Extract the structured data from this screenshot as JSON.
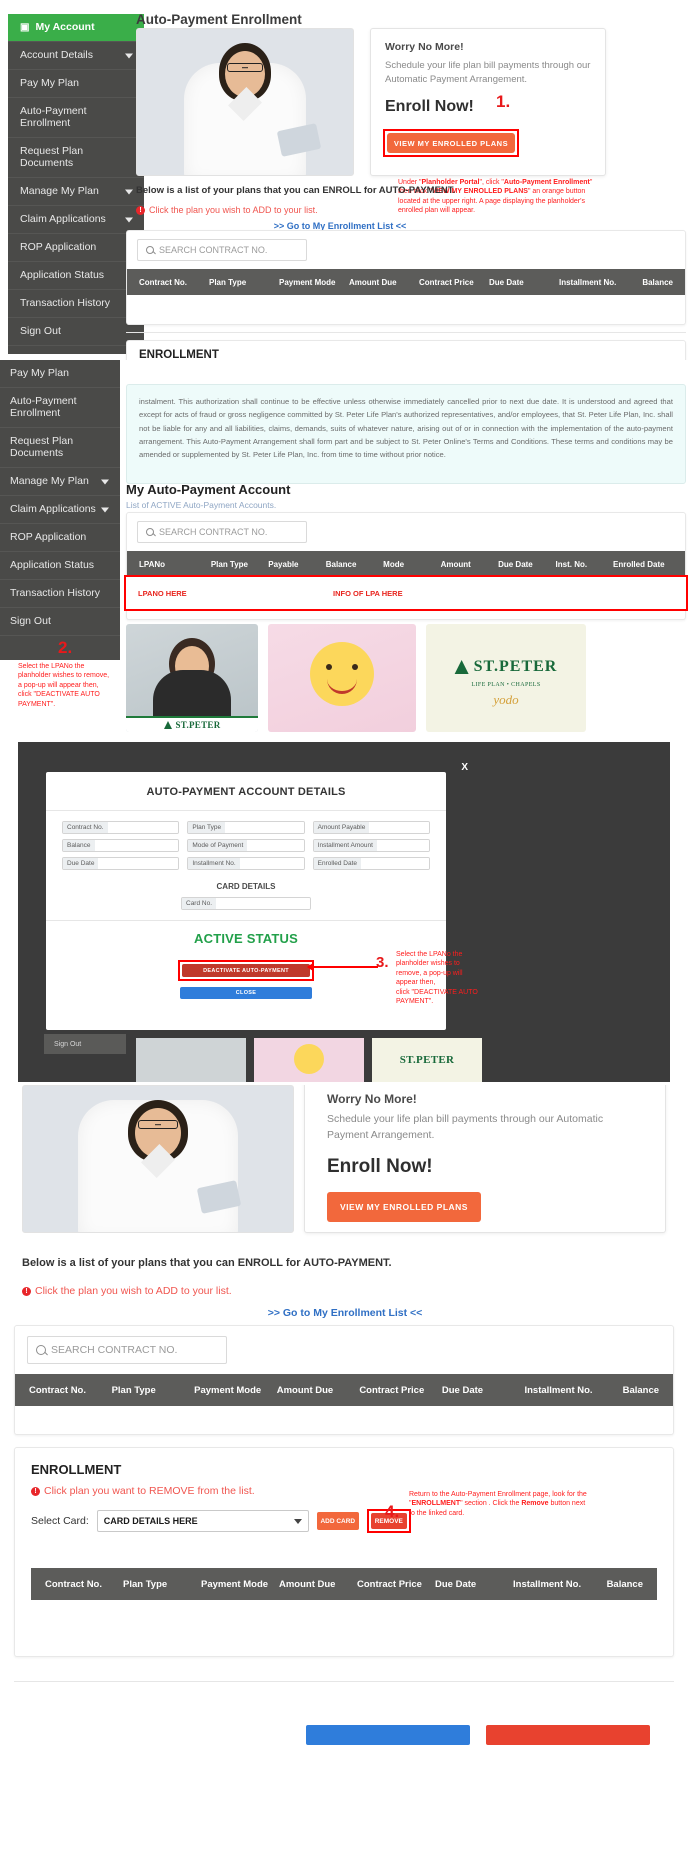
{
  "page": {
    "title": "Auto-Payment Enrollment"
  },
  "sidebar": {
    "items": [
      {
        "label": "My Account",
        "icon": "briefcase-icon",
        "active": true,
        "caret": false
      },
      {
        "label": "Account Details",
        "active": false,
        "caret": true
      },
      {
        "label": "Pay My Plan",
        "active": false,
        "caret": false
      },
      {
        "label": "Auto-Payment Enrollment",
        "active": false,
        "caret": false,
        "two_line": true
      },
      {
        "label": "Request Plan Documents",
        "active": false,
        "caret": false,
        "two_line": true
      },
      {
        "label": "Manage My Plan",
        "active": false,
        "caret": true
      },
      {
        "label": "Claim Applications",
        "active": false,
        "caret": true
      },
      {
        "label": "ROP Application",
        "active": false,
        "caret": false
      },
      {
        "label": "Application Status",
        "active": false,
        "caret": false
      },
      {
        "label": "Transaction History",
        "active": false,
        "caret": false
      },
      {
        "label": "Sign Out",
        "active": false,
        "caret": false
      }
    ]
  },
  "promo": {
    "heading": "Worry No More!",
    "body": "Schedule your life plan bill payments through our Automatic Payment Arrangement.",
    "cta_heading": "Enroll Now!",
    "button_label": "VIEW MY ENROLLED PLANS"
  },
  "callouts": {
    "one": {
      "number": "1.",
      "text_html": "Under \"<b>Planholder Portal</b>\", click \"<b>Auto-Payment Enrollment</b>\" then click \"<b>VIEW MY ENROLLED PLANS</b>\" an orange button located at the upper right. A page displaying the planholder's enrolled plan will appear."
    },
    "two": {
      "number": "2.",
      "text_html": "Select the LPANo the planholder wishes to remove, a pop-up will appear then, click \"DEACTIVATE AUTO PAYMENT\"."
    },
    "three": {
      "number": "3.",
      "text_html": "Select the LPANo the planholder wishes to remove, a pop-up will appear then, click \"DEACTIVATE AUTO PAYMENT\"."
    },
    "four": {
      "number": "4.",
      "text_html": "Return to the Auto-Payment Enrollment page, look for the \"<b>ENROLLMENT</b>\" section . Click the <b>Remove</b> button next to the linked card."
    }
  },
  "enroll_list": {
    "lead": "Below is a list of your plans that you can ENROLL for AUTO-PAYMENT.",
    "warning": "Click the plan you wish to ADD to your list.",
    "go_link": ">> Go to My Enrollment List <<",
    "search_placeholder": "SEARCH CONTRACT NO.",
    "columns": [
      "Contract No.",
      "Plan Type",
      "Payment Mode",
      "Amount Due",
      "Contract Price",
      "Due Date",
      "Installment No.",
      "Balance"
    ]
  },
  "enrollment_panel": {
    "title": "ENROLLMENT",
    "warning": "Click plan you want to REMOVE from the list.",
    "select_card_label": "Select Card:",
    "select_card_value": "CARD DETAILS HERE",
    "add_card_label": "ADD CARD",
    "remove_label": "REMOVE",
    "columns": [
      "Contract No.",
      "Plan Type",
      "Payment Mode",
      "Amount Due",
      "Contract Price",
      "Due Date",
      "Installment No.",
      "Balance"
    ]
  },
  "legal": {
    "text": "instalment. This authorization shall continue to be effective unless otherwise immediately cancelled prior to next due date. It is understood and agreed that except for acts of fraud or gross negligence committed by St. Peter Life Plan's authorized representatives, and/or employees, that St. Peter Life Plan, Inc. shall not be liable for any and all liabilities, claims, demands, suits of whatever nature, arising out of or in connection with the implementation of the auto-payment arrangement. This Auto-Payment Arrangement shall form part and be subject to St. Peter Online's Terms and Conditions. These terms and conditions may be amended or supplemented by St. Peter Life Plan, Inc. from time to time without prior notice."
  },
  "my_account": {
    "title": "My Auto-Payment Account",
    "subtitle": "List of ACTIVE Auto-Payment Accounts.",
    "search_placeholder": "SEARCH CONTRACT NO.",
    "columns": [
      "LPANo",
      "Plan Type",
      "Payable",
      "Balance",
      "Mode",
      "Amount",
      "Due Date",
      "Inst. No.",
      "Enrolled Date"
    ],
    "row": {
      "lpano": "LPANO HERE",
      "info": "INFO OF LPA HERE"
    }
  },
  "photos": {
    "brand": "ST.PETER",
    "brand_sub1": "LIFE PLAN • CHAPELS",
    "brand_sub2": "yodo"
  },
  "modal": {
    "close_label": "X",
    "title": "AUTO-PAYMENT ACCOUNT DETAILS",
    "fields": [
      {
        "label": "Contract No.",
        "value": ""
      },
      {
        "label": "Plan Type",
        "value": ""
      },
      {
        "label": "Amount Payable",
        "value": ""
      },
      {
        "label": "Balance",
        "value": ""
      },
      {
        "label": "Mode of Payment",
        "value": ""
      },
      {
        "label": "Installment Amount",
        "value": ""
      },
      {
        "label": "Due Date",
        "value": ""
      },
      {
        "label": "Installment No.",
        "value": ""
      },
      {
        "label": "Enrolled Date",
        "value": ""
      }
    ],
    "card_section_title": "CARD DETAILS",
    "card_no_label": "Card No.",
    "card_no_value": "",
    "status": "ACTIVE STATUS",
    "deactivate_label": "DEACTIVATE AUTO-PAYMENT",
    "close_button_label": "CLOSE",
    "bg_signout": "Sign Out"
  }
}
